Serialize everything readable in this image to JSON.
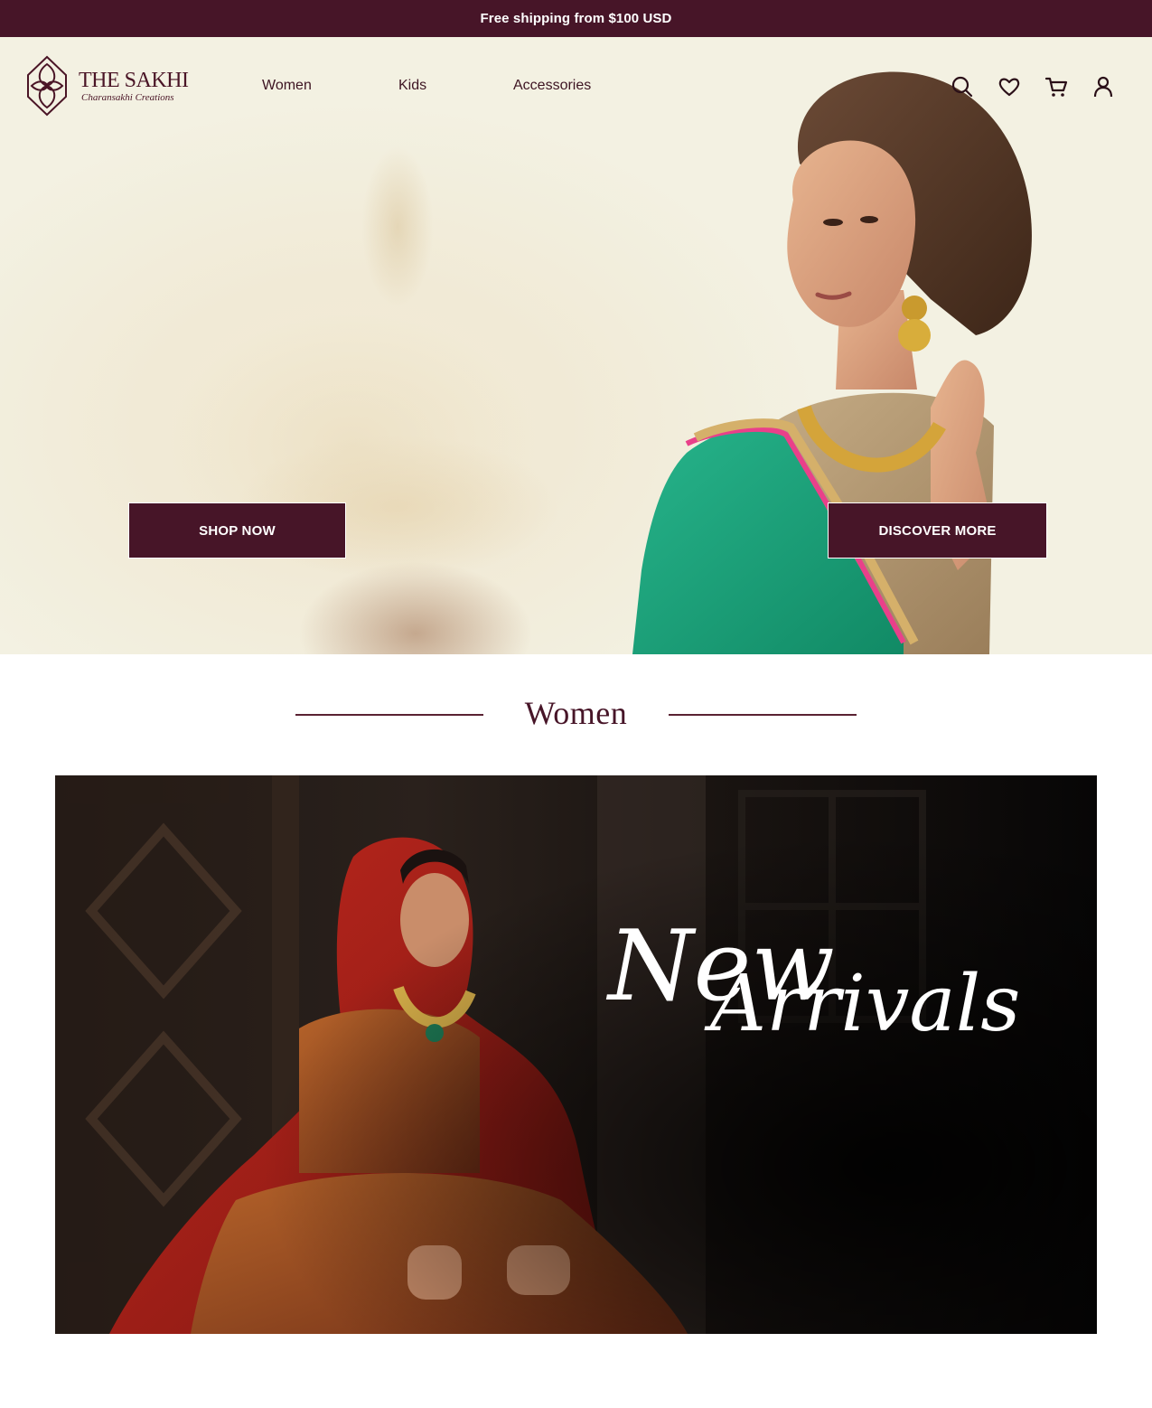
{
  "announcement": {
    "text": "Free shipping from $100 USD"
  },
  "brand": {
    "name": "THE SAKHI",
    "tagline": "Charansakhi Creations"
  },
  "nav": {
    "items": [
      {
        "label": "Women"
      },
      {
        "label": "Kids"
      },
      {
        "label": "Accessories"
      }
    ]
  },
  "header_icons": [
    "search-icon",
    "heart-icon",
    "cart-icon",
    "account-icon"
  ],
  "hero": {
    "primary_button": "SHOP NOW",
    "secondary_button": "DISCOVER MORE"
  },
  "section": {
    "title": "Women"
  },
  "banner": {
    "script_line1": "New",
    "script_line2": "Arrivals"
  },
  "colors": {
    "brand": "#471528",
    "hero_bg": "#f3f0df",
    "saree_green": "#1b9e77"
  }
}
